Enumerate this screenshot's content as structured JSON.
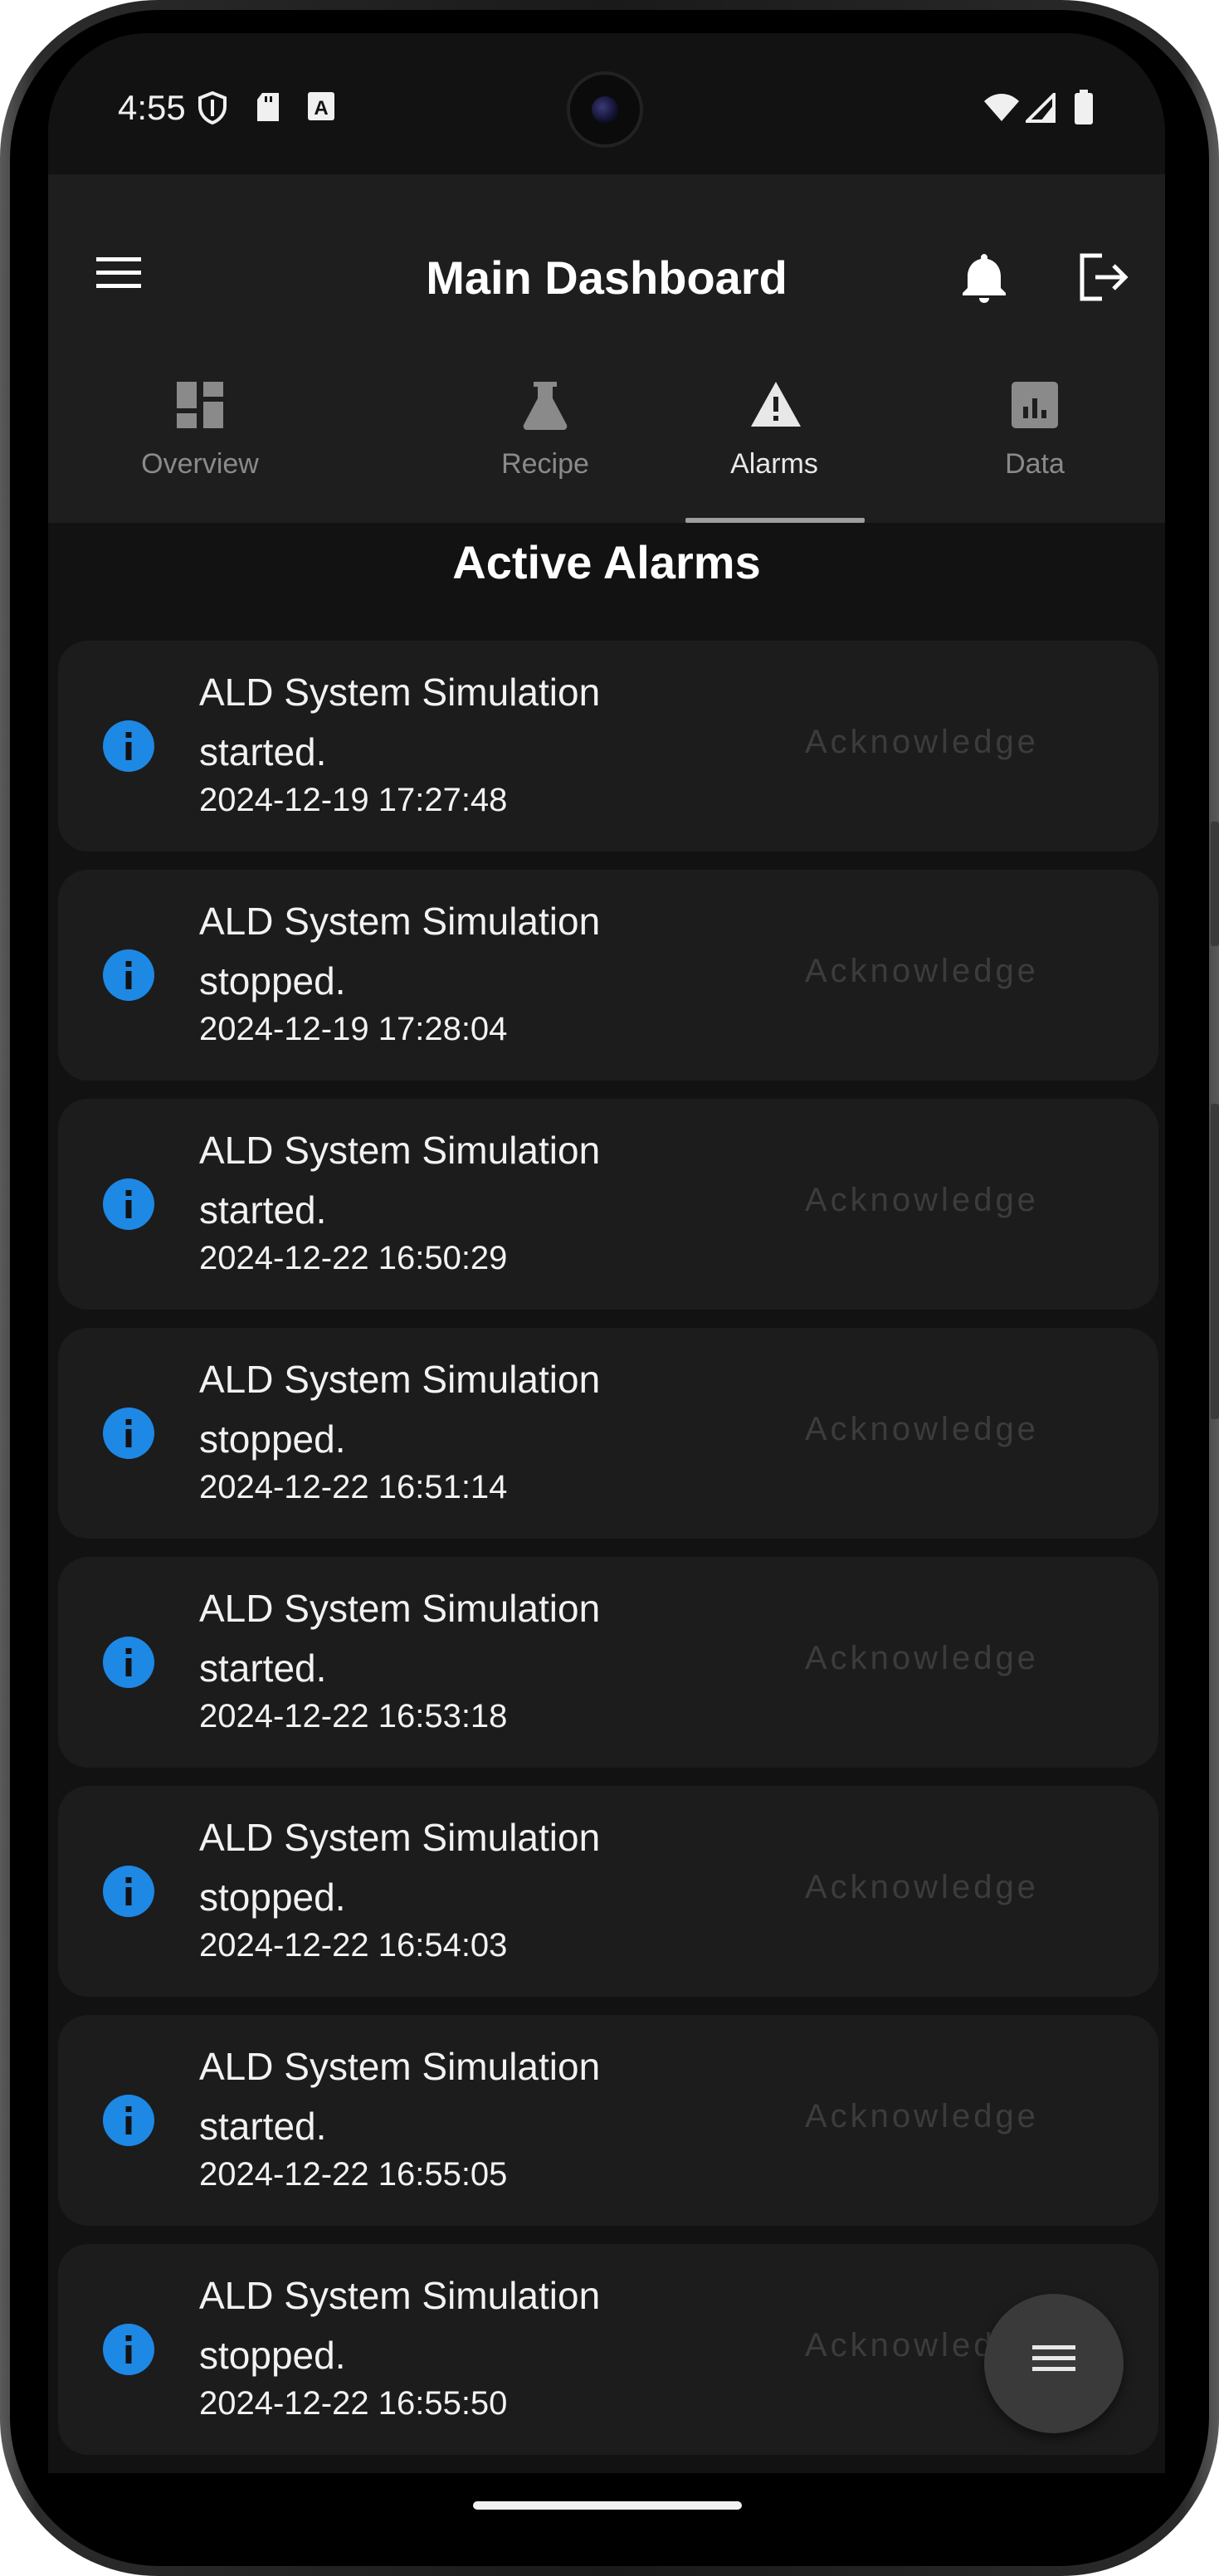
{
  "status_bar": {
    "time": "4:55"
  },
  "app_bar": {
    "title": "Main Dashboard",
    "menu_icon": "hamburger-menu-icon",
    "notification_icon": "bell-icon",
    "logout_icon": "logout-icon"
  },
  "tabs": [
    {
      "label": "Overview",
      "icon": "dashboard-icon",
      "active": false
    },
    {
      "label": "Recipe",
      "icon": "flask-icon",
      "active": false
    },
    {
      "label": "Alarms",
      "icon": "warning-icon",
      "active": true
    },
    {
      "label": "Data",
      "icon": "chart-icon",
      "active": false
    }
  ],
  "section": {
    "title": "Active Alarms"
  },
  "alarms": [
    {
      "message": "ALD System Simulation started.",
      "timestamp": "2024-12-19 17:27:48",
      "action": "Acknowledge"
    },
    {
      "message": "ALD System Simulation stopped.",
      "timestamp": "2024-12-19 17:28:04",
      "action": "Acknowledge"
    },
    {
      "message": "ALD System Simulation started.",
      "timestamp": "2024-12-22 16:50:29",
      "action": "Acknowledge"
    },
    {
      "message": "ALD System Simulation stopped.",
      "timestamp": "2024-12-22 16:51:14",
      "action": "Acknowledge"
    },
    {
      "message": "ALD System Simulation started.",
      "timestamp": "2024-12-22 16:53:18",
      "action": "Acknowledge"
    },
    {
      "message": "ALD System Simulation stopped.",
      "timestamp": "2024-12-22 16:54:03",
      "action": "Acknowledge"
    },
    {
      "message": "ALD System Simulation started.",
      "timestamp": "2024-12-22 16:55:05",
      "action": "Acknowledge"
    },
    {
      "message": "ALD System Simulation stopped.",
      "timestamp": "2024-12-22 16:55:50",
      "action": "Acknowledge"
    }
  ],
  "fab": {
    "icon": "menu-lines-icon"
  },
  "colors": {
    "info_icon": "#1e88e5",
    "background": "#121212",
    "card": "#1c1c1c"
  }
}
